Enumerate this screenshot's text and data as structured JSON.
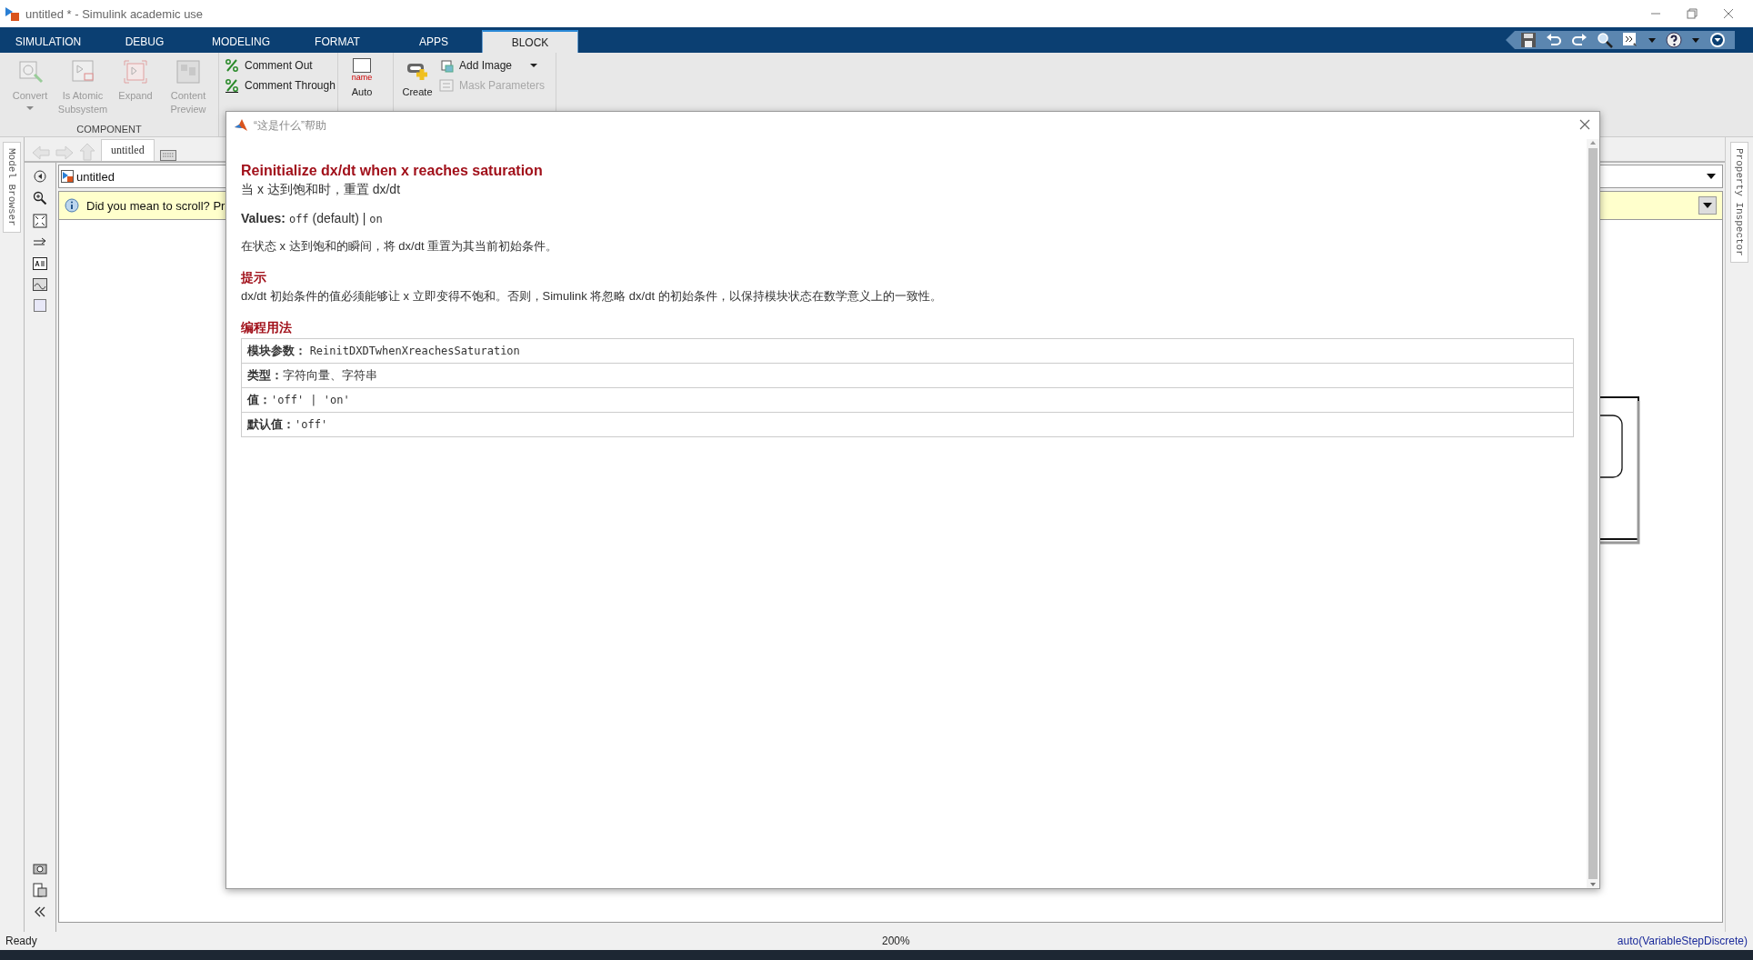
{
  "window": {
    "title": "untitled * - Simulink academic use"
  },
  "tabs": [
    {
      "label": "SIMULATION",
      "selected": false
    },
    {
      "label": "DEBUG",
      "selected": false
    },
    {
      "label": "MODELING",
      "selected": false
    },
    {
      "label": "FORMAT",
      "selected": false
    },
    {
      "label": "APPS",
      "selected": false
    },
    {
      "label": "BLOCK",
      "selected": true
    }
  ],
  "ribbon": {
    "component_buttons": [
      {
        "label": "Convert",
        "disabled": true,
        "has_menu": true
      },
      {
        "label": "Is Atomic Subsystem",
        "disabled": true,
        "has_menu": false
      },
      {
        "label": "Expand",
        "disabled": true,
        "has_menu": false
      },
      {
        "label": "Content Preview",
        "disabled": true,
        "has_menu": false
      }
    ],
    "component_label": "COMPONENT",
    "comment_buttons": [
      {
        "label": "Comment Out",
        "disabled": false
      },
      {
        "label": "Comment Through",
        "disabled": false
      }
    ],
    "auto_name": {
      "icon_text": "name",
      "label": "Auto"
    },
    "create_mask": {
      "label": "Create"
    },
    "mask_buttons": [
      {
        "label": "Add Image",
        "disabled": false,
        "has_menu": true
      },
      {
        "label": "Mask Parameters",
        "disabled": true,
        "has_menu": false
      }
    ]
  },
  "nav": {
    "tab": "untitled",
    "address": "untitled"
  },
  "info_bar": {
    "text": "Did you mean to scroll? Pr"
  },
  "side_tabs": {
    "left": "Model Browser",
    "right": "Property Inspector"
  },
  "dialog": {
    "title": "“这是什么”帮助",
    "heading": "Reinitialize dx/dt when x reaches saturation",
    "subtitle": "当 x 达到饱和时，重置 dx/dt",
    "values_label": "Values:",
    "values": [
      {
        "text": "off",
        "code": true
      },
      {
        "text": "(default) |",
        "code": false
      },
      {
        "text": "on",
        "code": true
      }
    ],
    "description": "在状态 x 达到饱和的瞬间，将 dx/dt 重置为其当前初始条件。",
    "tip_heading": "提示",
    "tip_text": "dx/dt 初始条件的值必须能够让 x 立即变得不饱和。否则，Simulink 将忽略 dx/dt 的初始条件，以保持模块状态在数学意义上的一致性。",
    "usage_heading": "编程用法",
    "usage_rows": [
      {
        "label": "模块参数：",
        "value": "ReinitDXDTwhenXreachesSaturation",
        "code": true
      },
      {
        "label": "类型：",
        "value": "字符向量、字符串",
        "code": false
      },
      {
        "label": "值：",
        "value": "'off' | 'on'",
        "code": true
      },
      {
        "label": "默认值：",
        "value": "'off'",
        "code": true
      }
    ]
  },
  "status_bar": {
    "state": "Ready",
    "zoom": "200%",
    "solver": "auto(VariableStepDiscrete)"
  }
}
